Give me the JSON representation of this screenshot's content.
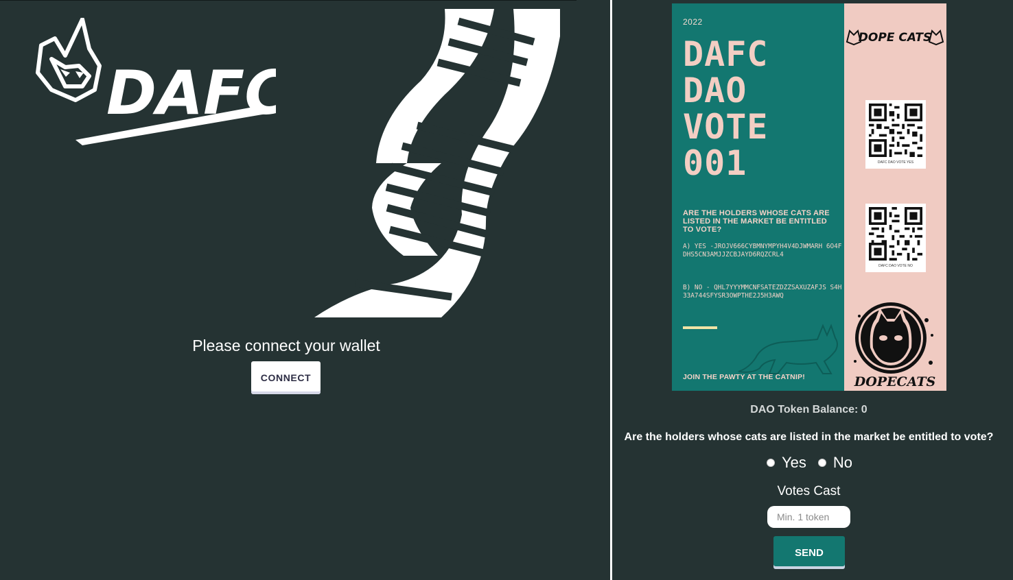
{
  "left": {
    "connect_prompt": "Please connect your wallet",
    "connect_label": "CONNECT",
    "logo_text": "DAFC"
  },
  "poster": {
    "year": "2022",
    "title": "DAFC DAO VOTE 001",
    "question": "ARE THE HOLDERS WHOSE CATS ARE LISTED IN THE MARKET BE ENTITLED TO VOTE?",
    "option_a": "A) YES -JROJV666CYBMNYMPYH4V4DJWMARH 6O4FDHS5CN3AMJJZCBJAYD6RQZCRL4",
    "option_b": "B) NO - QHL7YYYMMCNFSATEZDZZSAXUZAFJS S4H33A744SFYSR3OWPTHE2J5H3AWQ",
    "footer": "JOIN THE PAWTY AT THE CATNIP!",
    "brand": "DOPE CATS",
    "qr_yes_caption": "DAFC DAO VOTE YES",
    "qr_no_caption": "DAFC DAO VOTE NO",
    "badge_text": "DOPECATS"
  },
  "vote": {
    "balance": "DAO Token Balance: 0",
    "question": "Are the holders whose cats are listed in the market be entitled to vote?",
    "option_yes": "Yes",
    "option_no": "No",
    "votes_label": "Votes Cast",
    "votes_placeholder": "Min. 1 token",
    "send_label": "SEND"
  },
  "colors": {
    "background": "#253333",
    "teal": "#137770",
    "pink": "#f0cbc2"
  }
}
